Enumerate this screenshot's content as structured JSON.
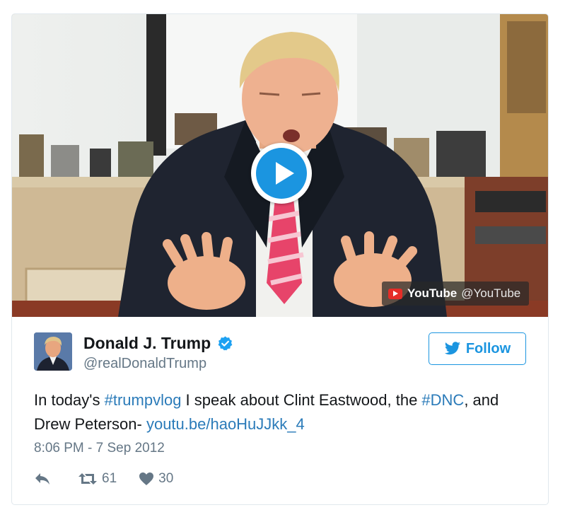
{
  "media": {
    "source_label": "YouTube",
    "source_handle": "@YouTube",
    "play_icon": "play-icon"
  },
  "tweet": {
    "author_name": "Donald J. Trump",
    "screen_name": "@realDonaldTrump",
    "follow_label": "Follow",
    "text_parts": {
      "t1": "In today's ",
      "hashtag1": "#trumpvlog",
      "t2": " I speak about Clint Eastwood, the ",
      "hashtag2": "#DNC",
      "t3": ", and Drew Peterson- ",
      "url": "youtu.be/haoHuJJkk_4"
    },
    "timestamp": "8:06 PM - 7 Sep 2012",
    "retweet_count": "61",
    "like_count": "30"
  },
  "colors": {
    "accent": "#1b95e0",
    "link": "#2b7bb9",
    "muted": "#657786",
    "text": "#14171a",
    "youtube_red": "#e52d27"
  }
}
